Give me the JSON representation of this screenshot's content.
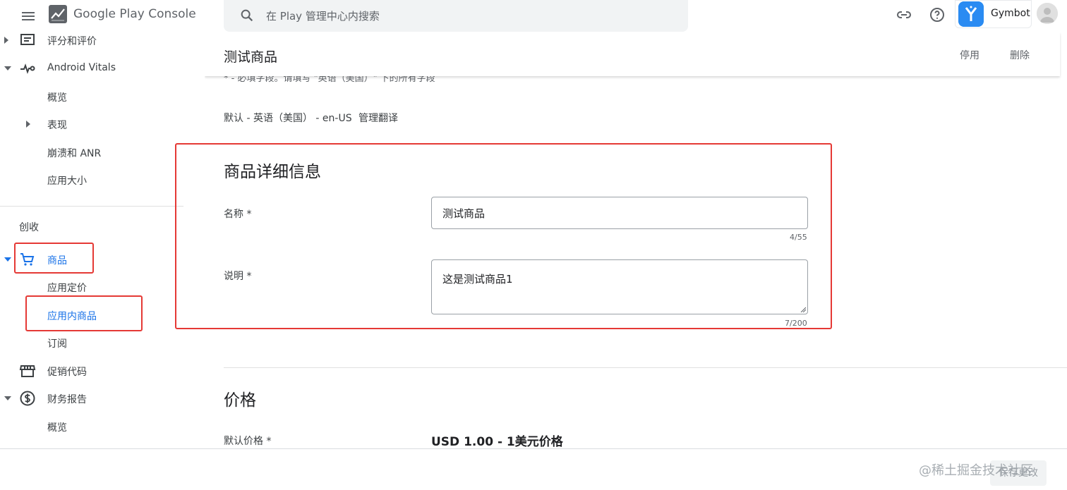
{
  "topbar": {
    "brand": "Google Play Console",
    "search_placeholder": "在 Play 管理中心内搜索",
    "account_name": "Gymbot",
    "icons": [
      "menu-icon",
      "play-console-logo",
      "search-icon",
      "link-icon",
      "help-icon",
      "app-icon",
      "avatar"
    ]
  },
  "sidebar": {
    "items": [
      {
        "label": "评分和评价",
        "icon": "reviews-icon"
      },
      {
        "label": "Android Vitals",
        "icon": "vitals-icon"
      },
      {
        "label": "概览"
      },
      {
        "label": "表现"
      },
      {
        "label": "崩溃和 ANR"
      },
      {
        "label": "应用大小"
      }
    ],
    "section_title": "创收",
    "monetize_items": [
      {
        "label": "商品",
        "icon": "cart-icon"
      },
      {
        "label": "应用定价"
      },
      {
        "label": "应用内商品"
      },
      {
        "label": "订阅"
      },
      {
        "label": "促销代码",
        "icon": "store-icon"
      },
      {
        "label": "财务报告",
        "icon": "dollar-icon"
      },
      {
        "label": "概览"
      }
    ]
  },
  "page": {
    "title": "测试商品",
    "deactivate_label": "停用",
    "delete_label": "删除",
    "hint": "* - 必填字段。请填写 \"英语（美国）\" 下的所有字段",
    "locale": "默认 - 英语（美国） - en-US",
    "manage_translations": "管理翻译"
  },
  "details": {
    "heading": "商品详细信息",
    "name_label": "名称 *",
    "name_value": "测试商品",
    "name_counter": "4/55",
    "desc_label": "说明 *",
    "desc_value": "这是测试商品1",
    "desc_counter": "7/200"
  },
  "price": {
    "heading": "价格",
    "default_label": "默认价格 *",
    "value": "USD 1.00 - 1美元价格"
  },
  "bottom": {
    "save_label": "保存更改",
    "watermark": "@稀土掘金技术社区"
  },
  "colors": {
    "accent": "#1a73e8",
    "highlight": "#e53935"
  }
}
